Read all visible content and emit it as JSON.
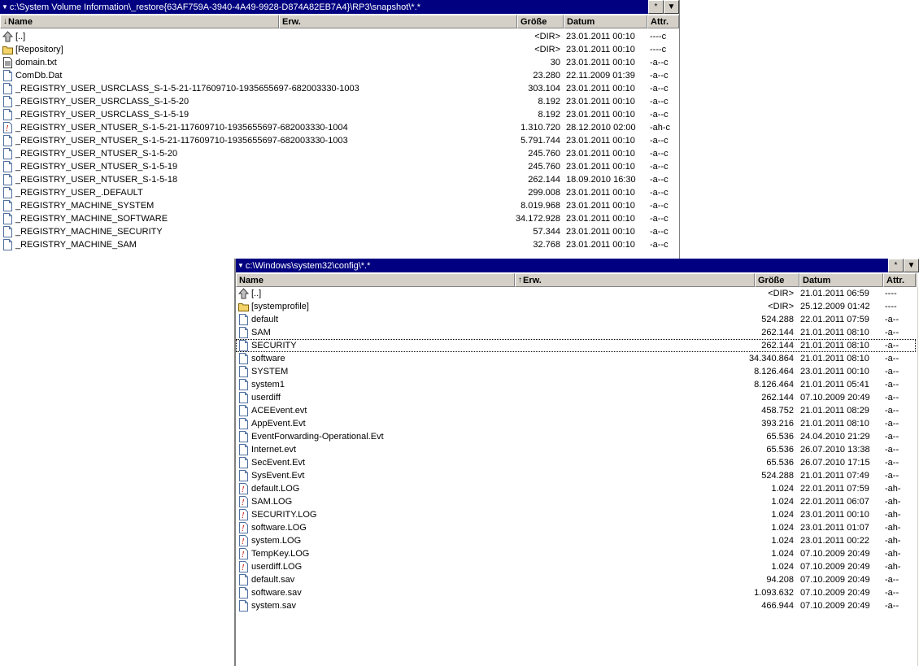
{
  "panel1": {
    "path": "c:\\System Volume Information\\_restore{63AF759A-3940-4A49-9928-D874A82EB7A4}\\RP3\\snapshot\\*.*",
    "columns": {
      "name": "Name",
      "ext": "Erw.",
      "size": "Größe",
      "date": "Datum",
      "attr": "Attr."
    },
    "rows": [
      {
        "icon": "up",
        "name": "[..]",
        "size": "<DIR>",
        "date": "23.01.2011 00:10",
        "attr": "----c"
      },
      {
        "icon": "folder",
        "name": "[Repository]",
        "size": "<DIR>",
        "date": "23.01.2011 00:10",
        "attr": "----c"
      },
      {
        "icon": "text",
        "name": "domain.txt",
        "size": "30",
        "date": "23.01.2011 00:10",
        "attr": "-a--c"
      },
      {
        "icon": "file",
        "name": "ComDb.Dat",
        "size": "23.280",
        "date": "22.11.2009 01:39",
        "attr": "-a--c"
      },
      {
        "icon": "file",
        "name": "_REGISTRY_USER_USRCLASS_S-1-5-21-117609710-1935655697-682003330-1003",
        "size": "303.104",
        "date": "23.01.2011 00:10",
        "attr": "-a--c"
      },
      {
        "icon": "file",
        "name": "_REGISTRY_USER_USRCLASS_S-1-5-20",
        "size": "8.192",
        "date": "23.01.2011 00:10",
        "attr": "-a--c"
      },
      {
        "icon": "file",
        "name": "_REGISTRY_USER_USRCLASS_S-1-5-19",
        "size": "8.192",
        "date": "23.01.2011 00:10",
        "attr": "-a--c"
      },
      {
        "icon": "hidden",
        "name": "_REGISTRY_USER_NTUSER_S-1-5-21-117609710-1935655697-682003330-1004",
        "size": "1.310.720",
        "date": "28.12.2010 02:00",
        "attr": "-ah-c"
      },
      {
        "icon": "file",
        "name": "_REGISTRY_USER_NTUSER_S-1-5-21-117609710-1935655697-682003330-1003",
        "size": "5.791.744",
        "date": "23.01.2011 00:10",
        "attr": "-a--c"
      },
      {
        "icon": "file",
        "name": "_REGISTRY_USER_NTUSER_S-1-5-20",
        "size": "245.760",
        "date": "23.01.2011 00:10",
        "attr": "-a--c"
      },
      {
        "icon": "file",
        "name": "_REGISTRY_USER_NTUSER_S-1-5-19",
        "size": "245.760",
        "date": "23.01.2011 00:10",
        "attr": "-a--c"
      },
      {
        "icon": "file",
        "name": "_REGISTRY_USER_NTUSER_S-1-5-18",
        "size": "262.144",
        "date": "18.09.2010 16:30",
        "attr": "-a--c"
      },
      {
        "icon": "file",
        "name": "_REGISTRY_USER_.DEFAULT",
        "size": "299.008",
        "date": "23.01.2011 00:10",
        "attr": "-a--c"
      },
      {
        "icon": "file",
        "name": "_REGISTRY_MACHINE_SYSTEM",
        "size": "8.019.968",
        "date": "23.01.2011 00:10",
        "attr": "-a--c"
      },
      {
        "icon": "file",
        "name": "_REGISTRY_MACHINE_SOFTWARE",
        "size": "34.172.928",
        "date": "23.01.2011 00:10",
        "attr": "-a--c"
      },
      {
        "icon": "file",
        "name": "_REGISTRY_MACHINE_SECURITY",
        "size": "57.344",
        "date": "23.01.2011 00:10",
        "attr": "-a--c"
      },
      {
        "icon": "file",
        "name": "_REGISTRY_MACHINE_SAM",
        "size": "32.768",
        "date": "23.01.2011 00:10",
        "attr": "-a--c"
      }
    ]
  },
  "panel2": {
    "path": "c:\\Windows\\system32\\config\\*.*",
    "columns": {
      "name": "Name",
      "ext": "Erw.",
      "size": "Größe",
      "date": "Datum",
      "attr": "Attr."
    },
    "selected_index": 4,
    "rows": [
      {
        "icon": "up",
        "name": "[..]",
        "size": "<DIR>",
        "date": "21.01.2011 06:59",
        "attr": "----"
      },
      {
        "icon": "folder",
        "name": "[systemprofile]",
        "size": "<DIR>",
        "date": "25.12.2009 01:42",
        "attr": "----"
      },
      {
        "icon": "file",
        "name": "default",
        "size": "524.288",
        "date": "22.01.2011 07:59",
        "attr": "-a--"
      },
      {
        "icon": "file",
        "name": "SAM",
        "size": "262.144",
        "date": "21.01.2011 08:10",
        "attr": "-a--"
      },
      {
        "icon": "file",
        "name": "SECURITY",
        "size": "262.144",
        "date": "21.01.2011 08:10",
        "attr": "-a--"
      },
      {
        "icon": "file",
        "name": "software",
        "size": "34.340.864",
        "date": "21.01.2011 08:10",
        "attr": "-a--"
      },
      {
        "icon": "file",
        "name": "SYSTEM",
        "size": "8.126.464",
        "date": "23.01.2011 00:10",
        "attr": "-a--"
      },
      {
        "icon": "file",
        "name": "system1",
        "size": "8.126.464",
        "date": "21.01.2011 05:41",
        "attr": "-a--"
      },
      {
        "icon": "file",
        "name": "userdiff",
        "size": "262.144",
        "date": "07.10.2009 20:49",
        "attr": "-a--"
      },
      {
        "icon": "file",
        "name": "ACEEvent.evt",
        "size": "458.752",
        "date": "21.01.2011 08:29",
        "attr": "-a--"
      },
      {
        "icon": "file",
        "name": "AppEvent.Evt",
        "size": "393.216",
        "date": "21.01.2011 08:10",
        "attr": "-a--"
      },
      {
        "icon": "file",
        "name": "EventForwarding-Operational.Evt",
        "size": "65.536",
        "date": "24.04.2010 21:29",
        "attr": "-a--"
      },
      {
        "icon": "file",
        "name": "Internet.evt",
        "size": "65.536",
        "date": "26.07.2010 13:38",
        "attr": "-a--"
      },
      {
        "icon": "file",
        "name": "SecEvent.Evt",
        "size": "65.536",
        "date": "26.07.2010 17:15",
        "attr": "-a--"
      },
      {
        "icon": "file",
        "name": "SysEvent.Evt",
        "size": "524.288",
        "date": "21.01.2011 07:49",
        "attr": "-a--"
      },
      {
        "icon": "hidden",
        "name": "default.LOG",
        "size": "1.024",
        "date": "22.01.2011 07:59",
        "attr": "-ah-"
      },
      {
        "icon": "hidden",
        "name": "SAM.LOG",
        "size": "1.024",
        "date": "22.01.2011 06:07",
        "attr": "-ah-"
      },
      {
        "icon": "hidden",
        "name": "SECURITY.LOG",
        "size": "1.024",
        "date": "23.01.2011 00:10",
        "attr": "-ah-"
      },
      {
        "icon": "hidden",
        "name": "software.LOG",
        "size": "1.024",
        "date": "23.01.2011 01:07",
        "attr": "-ah-"
      },
      {
        "icon": "hidden",
        "name": "system.LOG",
        "size": "1.024",
        "date": "23.01.2011 00:22",
        "attr": "-ah-"
      },
      {
        "icon": "hidden",
        "name": "TempKey.LOG",
        "size": "1.024",
        "date": "07.10.2009 20:49",
        "attr": "-ah-"
      },
      {
        "icon": "hidden",
        "name": "userdiff.LOG",
        "size": "1.024",
        "date": "07.10.2009 20:49",
        "attr": "-ah-"
      },
      {
        "icon": "file",
        "name": "default.sav",
        "size": "94.208",
        "date": "07.10.2009 20:49",
        "attr": "-a--"
      },
      {
        "icon": "file",
        "name": "software.sav",
        "size": "1.093.632",
        "date": "07.10.2009 20:49",
        "attr": "-a--"
      },
      {
        "icon": "file",
        "name": "system.sav",
        "size": "466.944",
        "date": "07.10.2009 20:49",
        "attr": "-a--"
      }
    ]
  },
  "titlebar_buttons": {
    "star": "*",
    "dropdown": "▼"
  },
  "colors": {
    "titlebar": "#000080",
    "header": "#d4d0c8",
    "folder": "#f2d46a"
  }
}
